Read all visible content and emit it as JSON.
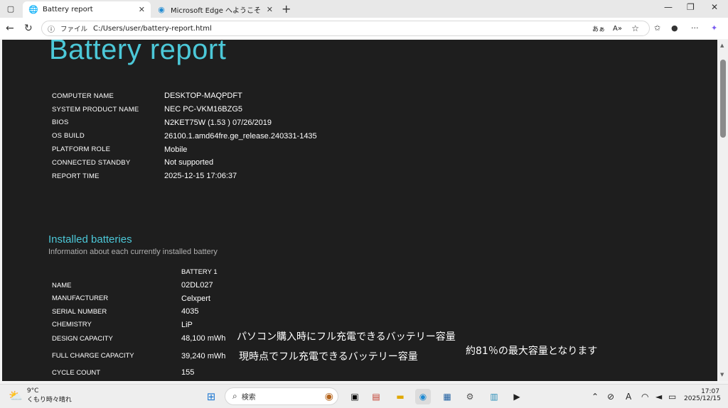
{
  "browser": {
    "tabs": [
      {
        "title": "Battery report",
        "active": true
      },
      {
        "title": "Microsoft Edge へようこそ",
        "active": false
      }
    ],
    "address": {
      "label": "ファイル",
      "url": "C:/Users/user/battery-report.html"
    },
    "toolbar_icons": [
      "read-aloud-icon",
      "immersive-reader-icon",
      "favorite-star-icon",
      "collections-icon",
      "profile-icon",
      "more-icon",
      "copilot-icon"
    ],
    "read_aloud_glyph": "あぁ"
  },
  "report": {
    "title": "Battery report",
    "system_info": [
      {
        "key": "COMPUTER NAME",
        "value": "DESKTOP-MAQPDFT"
      },
      {
        "key": "SYSTEM PRODUCT NAME",
        "value": "NEC PC-VKM16BZG5"
      },
      {
        "key": "BIOS",
        "value": "N2KET75W (1.53 ) 07/26/2019"
      },
      {
        "key": "OS BUILD",
        "value": "26100.1.amd64fre.ge_release.240331-1435"
      },
      {
        "key": "PLATFORM ROLE",
        "value": "Mobile"
      },
      {
        "key": "CONNECTED STANDBY",
        "value": "Not supported"
      },
      {
        "key": "REPORT TIME",
        "value": "2025-12-15   17:06:37"
      }
    ],
    "installed": {
      "title": "Installed batteries",
      "subtitle": "Information about each currently installed battery",
      "column": "BATTERY 1",
      "rows": [
        {
          "key": "NAME",
          "value": "02DL027"
        },
        {
          "key": "MANUFACTURER",
          "value": "Celxpert"
        },
        {
          "key": "SERIAL NUMBER",
          "value": "4035"
        },
        {
          "key": "CHEMISTRY",
          "value": "LiP"
        },
        {
          "key": "DESIGN CAPACITY",
          "value": "48,100 mWh"
        },
        {
          "key": "FULL CHARGE CAPACITY",
          "value": "39,240 mWh"
        },
        {
          "key": "CYCLE COUNT",
          "value": "155"
        }
      ]
    },
    "notes": {
      "design": "パソコン購入時にフル充電できるバッテリー容量",
      "full": "現時点でフル充電できるバッテリー容量",
      "ratio": "約81％の最大容量となります"
    }
  },
  "taskbar": {
    "weather": {
      "temp": "9°C",
      "desc": "くもり時々晴れ"
    },
    "search_placeholder": "検索",
    "time": "17:07",
    "date": "2025/12/15",
    "tray_letter": "A"
  },
  "colors": {
    "accent": "#4cc8d8",
    "report_bg": "#1e1e1e"
  }
}
